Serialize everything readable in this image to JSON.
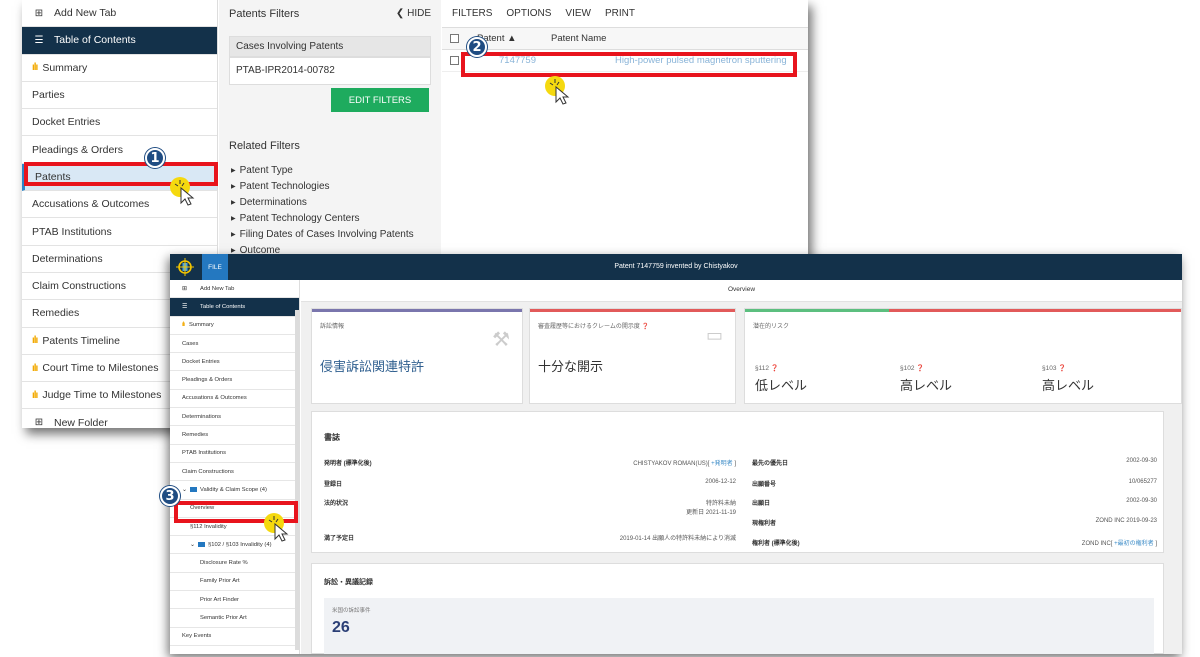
{
  "back_window": {
    "sidebar": {
      "add_tab": "Add New Tab",
      "toc": "Table of Contents",
      "items": [
        {
          "label": "Summary",
          "bar": true
        },
        {
          "label": "Parties",
          "bar": false
        },
        {
          "label": "Docket Entries",
          "bar": false
        },
        {
          "label": "Pleadings & Orders",
          "bar": false
        },
        {
          "label": "Patents",
          "bar": false
        },
        {
          "label": "Accusations & Outcomes",
          "bar": false
        },
        {
          "label": "PTAB Institutions",
          "bar": false
        },
        {
          "label": "Determinations",
          "bar": false
        },
        {
          "label": "Claim Constructions",
          "bar": false
        },
        {
          "label": "Remedies",
          "bar": false
        },
        {
          "label": "Patents Timeline",
          "bar": true
        },
        {
          "label": "Court Time to Milestones",
          "bar": true
        },
        {
          "label": "Judge Time to Milestones",
          "bar": true
        }
      ],
      "new_folder": "New Folder"
    },
    "filters": {
      "title": "Patents Filters",
      "hide": "HIDE",
      "case_label": "Cases Involving Patents",
      "case_value": "PTAB-IPR2014-00782",
      "edit_button": "EDIT FILTERS",
      "related_title": "Related Filters",
      "related": [
        "Patent Type",
        "Patent Technologies",
        "Determinations",
        "Patent Technology Centers",
        "Filing Dates of Cases Involving Patents",
        "Outcome"
      ]
    },
    "main": {
      "tabs": [
        "FILTERS",
        "OPTIONS",
        "VIEW",
        "PRINT"
      ],
      "col_patent": "Patent ▲",
      "col_name": "Patent Name",
      "row_number": "7147759",
      "row_name": "High-power pulsed magnetron sputtering"
    }
  },
  "front_window": {
    "file_tab": "FILE",
    "title": "Patent 7147759 invented by Chistyakov",
    "overview_header": "Overview",
    "sidebar": {
      "add_tab": "Add New Tab",
      "toc": "Table of Contents",
      "items": [
        {
          "label": "Summary",
          "bar": true,
          "level": 0
        },
        {
          "label": "Cases",
          "bar": false,
          "level": 0
        },
        {
          "label": "Docket Entries",
          "bar": false,
          "level": 0
        },
        {
          "label": "Pleadings & Orders",
          "bar": false,
          "level": 0
        },
        {
          "label": "Accusations & Outcomes",
          "bar": false,
          "level": 0
        },
        {
          "label": "Determinations",
          "bar": false,
          "level": 0
        },
        {
          "label": "Remedies",
          "bar": false,
          "level": 0
        },
        {
          "label": "PTAB Institutions",
          "bar": false,
          "level": 0
        },
        {
          "label": "Claim Constructions",
          "bar": false,
          "level": 0
        },
        {
          "label": "Validity & Claim Scope (4)",
          "bar": false,
          "level": 0,
          "folder": true
        },
        {
          "label": "Overview",
          "bar": false,
          "level": 1
        },
        {
          "label": "§112 Invalidity",
          "bar": false,
          "level": 1
        },
        {
          "label": "§102 / §103 Invalidity (4)",
          "bar": false,
          "level": 1,
          "folder": true
        },
        {
          "label": "Disclosure Rate %",
          "bar": false,
          "level": 2
        },
        {
          "label": "Family Prior Art",
          "bar": false,
          "level": 2
        },
        {
          "label": "Prior Art Finder",
          "bar": false,
          "level": 2
        },
        {
          "label": "Semantic Prior Art",
          "bar": false,
          "level": 2
        },
        {
          "label": "Key Events",
          "bar": false,
          "level": 0
        }
      ]
    },
    "cards": {
      "litigation_label": "訴訟情報",
      "litigation_value": "侵害訴訟関連特許",
      "disclosure_label": "審査履歴等におけるクレームの開示度 ❓",
      "disclosure_value": "十分な開示",
      "risk_label": "潜在的リスク",
      "risks": [
        {
          "label": "§112 ❓",
          "value": "低レベル"
        },
        {
          "label": "§102 ❓",
          "value": "高レベル"
        },
        {
          "label": "§103 ❓",
          "value": "高レベル"
        }
      ]
    },
    "biblio": {
      "title": "書誌",
      "left": [
        {
          "k": "発明者 (標準化後)",
          "v": "CHISTYAKOV ROMAN(US)[ +発明者 ]"
        },
        {
          "k": "登録日",
          "v": "2006-12-12"
        },
        {
          "k": "法的状況",
          "v": "特許料未納",
          "v2": "更新日 2021-11-19"
        },
        {
          "k": "満了予定日",
          "v": "2019-01-14 出願人の特許料未納により消滅"
        }
      ],
      "right": [
        {
          "k": "最先の優先日",
          "v": "2002-09-30"
        },
        {
          "k": "出願番号",
          "v": "10/065277"
        },
        {
          "k": "出願日",
          "v": "2002-09-30"
        },
        {
          "k": "現権利者",
          "v": "ZOND INC 2019-09-23"
        },
        {
          "k": "権利者 (標準化後)",
          "v": "ZOND INC[ +最初の権利者 ]"
        }
      ]
    },
    "litigation": {
      "title": "訴訟・異議記録",
      "us_label": "米国の訴訟事件",
      "us_count": "26"
    }
  },
  "annotations": {
    "step1": "1",
    "step2": "2",
    "step3": "3",
    "highlight_color": "#e8141d",
    "badge_color": "#1f4c82"
  }
}
